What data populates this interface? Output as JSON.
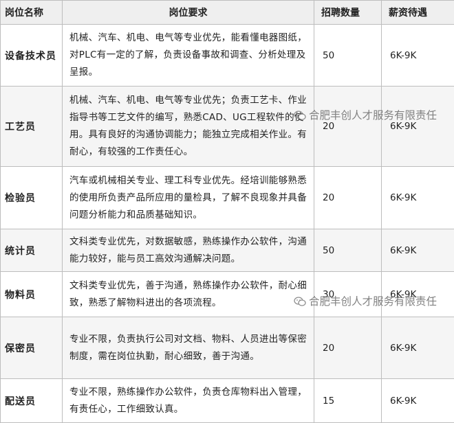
{
  "table": {
    "headers": [
      "岗位名称",
      "岗位要求",
      "招聘数量",
      "薪资待遇"
    ],
    "rows": [
      {
        "name": "设备技术员",
        "req": "机械、汽车、机电、电气等专业优先，能看懂电器图纸，对PLC有一定的了解，负责设备事故和调查、分析处理及呈报。",
        "count": "50",
        "salary": "6K-9K"
      },
      {
        "name": "工艺员",
        "req": "机械、汽车、机电、电气等专业优先；负责工艺卡、作业指导书等工艺文件的编写，熟悉CAD、UG工程软件的使用。具有良好的沟通协调能力；能独立完成相关作业。有耐心，有较强的工作责任心。",
        "count": "20",
        "salary": "6K-9K"
      },
      {
        "name": "检验员",
        "req": "汽车或机械相关专业、理工科专业优先。经培训能够熟悉的使用所负责产品所应用的量检具，了解不良现象并具备问题分析能力和品质基础知识。",
        "count": "20",
        "salary": "6K-9K"
      },
      {
        "name": "统计员",
        "req": "文科类专业优先，对数据敏感，熟练操作办公软件，沟通能力较好，能与员工高效沟通解决问题。",
        "count": "50",
        "salary": "6K-9K"
      },
      {
        "name": "物料员",
        "req": "文科类专业优先，善于沟通，熟练操作办公软件，耐心细致，熟悉了解物料进出的各项流程。",
        "count": "30",
        "salary": "6K-9K"
      },
      {
        "name": "保密员",
        "req": "专业不限，负责执行公司对文档、物料、人员进出等保密制度，需在岗位执勤，耐心细致，善于沟通。",
        "count": "20",
        "salary": "6K-9K"
      },
      {
        "name": "配送员",
        "req": "专业不限，熟练操作办公软件，负责仓库物料出入管理，有责任心，工作细致认真。",
        "count": "15",
        "salary": "6K-9K"
      }
    ]
  },
  "watermarks": [
    {
      "icon": "wechat-icon",
      "text": "合肥丰创人才服务有限责任"
    },
    {
      "icon": "wechat-icon",
      "text": "合肥丰创人才服务有限责任"
    }
  ]
}
